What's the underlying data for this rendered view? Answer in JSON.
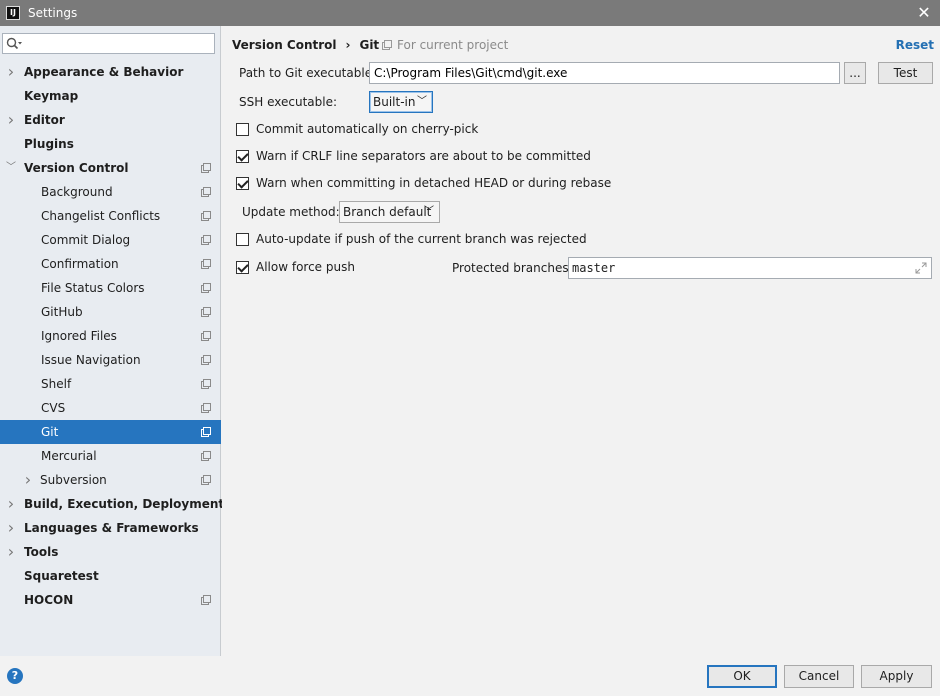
{
  "window": {
    "title": "Settings",
    "app_icon_text": "IJ"
  },
  "search": {
    "value": "",
    "placeholder": ""
  },
  "tree": [
    {
      "label": "Appearance & Behavior",
      "level": "top",
      "arrow": "right",
      "project": false,
      "selected": false
    },
    {
      "label": "Keymap",
      "level": "top",
      "arrow": "",
      "project": false,
      "selected": false
    },
    {
      "label": "Editor",
      "level": "top",
      "arrow": "right",
      "project": false,
      "selected": false
    },
    {
      "label": "Plugins",
      "level": "top",
      "arrow": "",
      "project": false,
      "selected": false
    },
    {
      "label": "Version Control",
      "level": "top",
      "arrow": "down",
      "project": true,
      "selected": false
    },
    {
      "label": "Background",
      "level": "child",
      "arrow": "",
      "project": true,
      "selected": false
    },
    {
      "label": "Changelist Conflicts",
      "level": "child",
      "arrow": "",
      "project": true,
      "selected": false
    },
    {
      "label": "Commit Dialog",
      "level": "child",
      "arrow": "",
      "project": true,
      "selected": false
    },
    {
      "label": "Confirmation",
      "level": "child",
      "arrow": "",
      "project": true,
      "selected": false
    },
    {
      "label": "File Status Colors",
      "level": "child",
      "arrow": "",
      "project": true,
      "selected": false
    },
    {
      "label": "GitHub",
      "level": "child",
      "arrow": "",
      "project": true,
      "selected": false
    },
    {
      "label": "Ignored Files",
      "level": "child",
      "arrow": "",
      "project": true,
      "selected": false
    },
    {
      "label": "Issue Navigation",
      "level": "child",
      "arrow": "",
      "project": true,
      "selected": false
    },
    {
      "label": "Shelf",
      "level": "child",
      "arrow": "",
      "project": true,
      "selected": false
    },
    {
      "label": "CVS",
      "level": "child",
      "arrow": "",
      "project": true,
      "selected": false
    },
    {
      "label": "Git",
      "level": "child",
      "arrow": "",
      "project": true,
      "selected": true
    },
    {
      "label": "Mercurial",
      "level": "child",
      "arrow": "",
      "project": true,
      "selected": false
    },
    {
      "label": "Subversion",
      "level": "subchild",
      "arrow": "right",
      "project": true,
      "selected": false
    },
    {
      "label": "Build, Execution, Deployment",
      "level": "top",
      "arrow": "right",
      "project": false,
      "selected": false
    },
    {
      "label": "Languages & Frameworks",
      "level": "top",
      "arrow": "right",
      "project": false,
      "selected": false
    },
    {
      "label": "Tools",
      "level": "top",
      "arrow": "right",
      "project": false,
      "selected": false
    },
    {
      "label": "Squaretest",
      "level": "top",
      "arrow": "",
      "project": false,
      "selected": false
    },
    {
      "label": "HOCON",
      "level": "top",
      "arrow": "",
      "project": true,
      "selected": false
    }
  ],
  "header": {
    "crumb_parent": "Version Control",
    "crumb_sep": "›",
    "crumb_current": "Git",
    "for_project": "For current project",
    "reset": "Reset"
  },
  "git": {
    "path_label": "Path to Git executable:",
    "path_value": "C:\\Program Files\\Git\\cmd\\git.exe",
    "browse_label": "...",
    "test_label": "Test",
    "ssh_label": "SSH executable:",
    "ssh_value": "Built-in",
    "update_label": "Update method:",
    "update_value": "Branch default",
    "protected_label": "Protected branches:",
    "protected_value": "master"
  },
  "checkboxes": [
    {
      "label": "Commit automatically on cherry-pick",
      "checked": false
    },
    {
      "label": "Warn if CRLF line separators are about to be committed",
      "checked": true
    },
    {
      "label": "Warn when committing in detached HEAD or during rebase",
      "checked": true
    },
    {
      "label": "Auto-update if push of the current branch was rejected",
      "checked": false
    },
    {
      "label": "Allow force push",
      "checked": true
    }
  ],
  "footer": {
    "help": "?",
    "ok": "OK",
    "cancel": "Cancel",
    "apply": "Apply"
  },
  "colors": {
    "selection": "#2675bf",
    "link": "#2470b3",
    "titlebar": "#7a7a7a"
  }
}
